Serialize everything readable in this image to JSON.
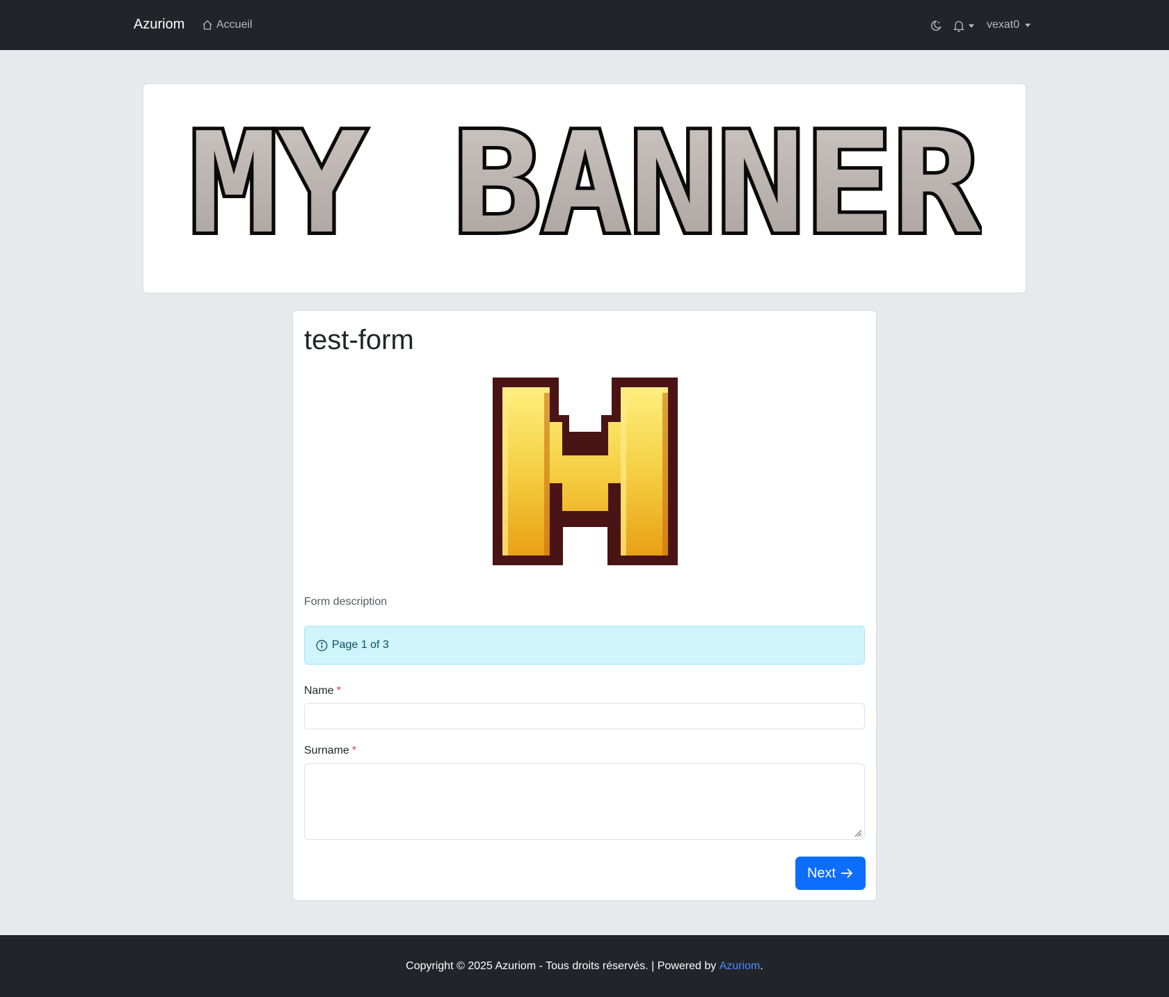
{
  "navbar": {
    "brand": "Azuriom",
    "home_label": "Accueil",
    "username": "vexat0"
  },
  "banner": {
    "text": "MY BANNER"
  },
  "form": {
    "title": "test-form",
    "logo_letter": "H",
    "description": "Form description",
    "page_info": "Page 1 of 3",
    "fields": [
      {
        "label": "Name",
        "required_mark": "*",
        "value": ""
      },
      {
        "label": "Surname",
        "required_mark": "*",
        "value": ""
      }
    ],
    "next_label": "Next"
  },
  "footer": {
    "copyright": "Copyright © 2025 Azuriom - Tous droits réservés. | Powered by ",
    "link_label": "Azuriom",
    "suffix": "."
  },
  "colors": {
    "navbar_bg": "#212529",
    "page_bg": "#e6eaed",
    "primary": "#0d6efd",
    "alert_bg": "#cff4fc",
    "logo_gold": "#f5c22e",
    "logo_outline": "#4a1414"
  }
}
